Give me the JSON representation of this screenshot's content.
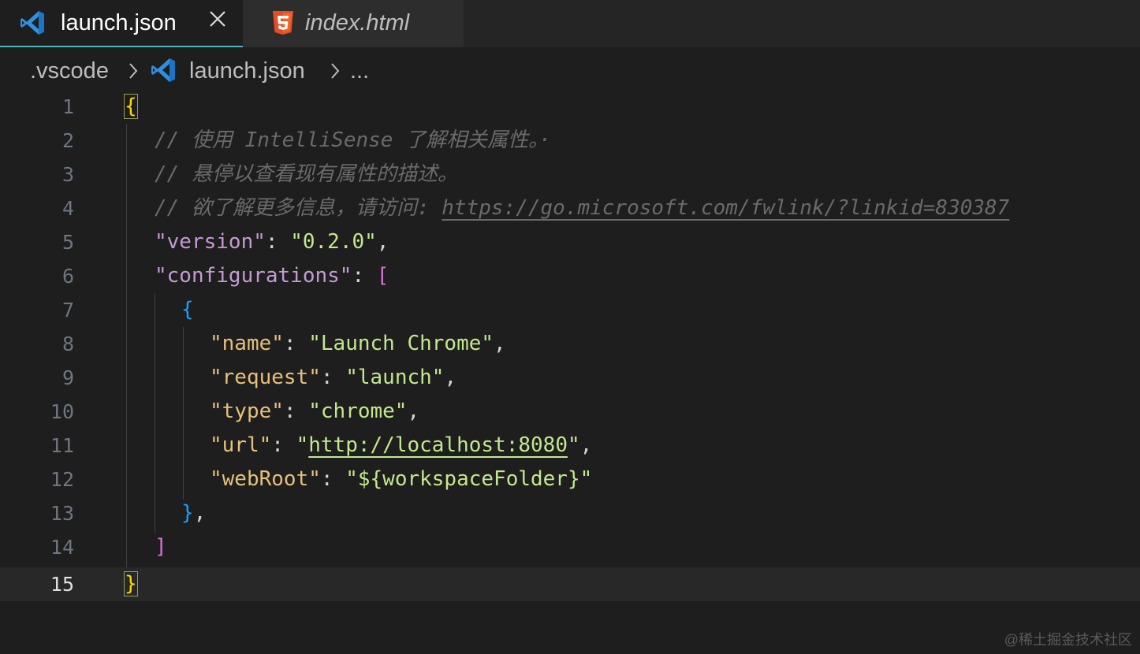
{
  "tabs": [
    {
      "label": "launch.json",
      "icon": "vscode-icon",
      "active": true
    },
    {
      "label": "index.html",
      "icon": "html5-icon",
      "active": false
    }
  ],
  "breadcrumb": {
    "folder": ".vscode",
    "file": "launch.json",
    "more": "..."
  },
  "editor": {
    "line_numbers": [
      "1",
      "2",
      "3",
      "4",
      "5",
      "6",
      "7",
      "8",
      "9",
      "10",
      "11",
      "12",
      "13",
      "14",
      "15"
    ],
    "current_line": "15",
    "lines": {
      "l1_brace": "{",
      "l2_comment": "// 使用 IntelliSense 了解相关属性。·",
      "l3_comment": "// 悬停以查看现有属性的描述。",
      "l4_comment": "// 欲了解更多信息，请访问: ",
      "l4_link": "https://go.microsoft.com/fwlink/?linkid=830387",
      "l5_key": "\"version\"",
      "l5_value": "\"0.2.0\"",
      "l6_key": "\"configurations\"",
      "l6_bracket": "[",
      "l7_brace": "{",
      "l8_key": "\"name\"",
      "l8_value": "\"Launch Chrome\"",
      "l9_key": "\"request\"",
      "l9_value": "\"launch\"",
      "l10_key": "\"type\"",
      "l10_value": "\"chrome\"",
      "l11_key": "\"url\"",
      "l11_value_q1": "\"",
      "l11_value_link": "http://localhost:8080",
      "l11_value_q2": "\"",
      "l12_key": "\"webRoot\"",
      "l12_value": "\"${workspaceFolder}\"",
      "l13_brace": "}",
      "l14_bracket": "]",
      "l15_brace": "}"
    }
  },
  "watermark": "@稀土掘金技术社区",
  "colors": {
    "background": "#1e1e1e",
    "tab_active_border": "#4fb3bd",
    "key_purple": "#c39bd3",
    "key_yellow": "#e6c07b",
    "string": "#c3e88d",
    "brace_gold": "#ffd700",
    "bracket_pink": "#da70d6",
    "brace_blue": "#179fff"
  }
}
